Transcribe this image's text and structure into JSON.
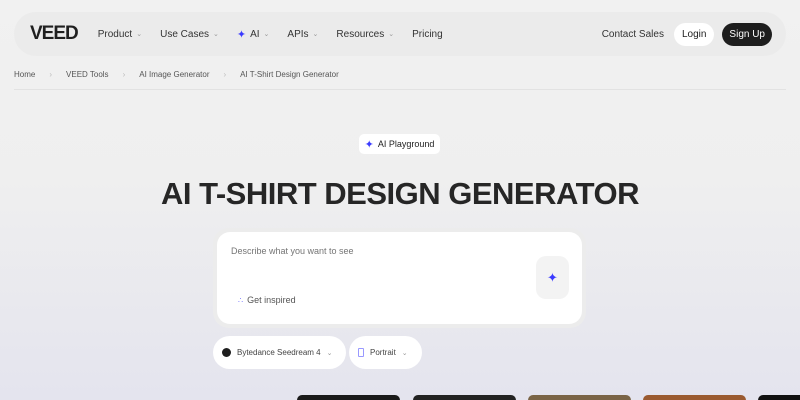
{
  "nav": {
    "logo": "VEED",
    "items": [
      {
        "label": "Product"
      },
      {
        "label": "Use Cases"
      },
      {
        "label": "AI"
      },
      {
        "label": "APIs"
      },
      {
        "label": "Resources"
      },
      {
        "label": "Pricing"
      }
    ],
    "contact": "Contact Sales",
    "login": "Login",
    "signup": "Sign Up"
  },
  "breadcrumb": [
    "Home",
    "VEED Tools",
    "AI Image Generator",
    "AI T-Shirt Design Generator"
  ],
  "badge": "AI Playground",
  "title": "AI T-SHIRT DESIGN GENERATOR",
  "prompt": {
    "placeholder": "Describe what you want to see",
    "inspire": "Get inspired"
  },
  "model": "Bytedance Seedream 4",
  "aspect": "Portrait",
  "accent": "#3b3bff"
}
